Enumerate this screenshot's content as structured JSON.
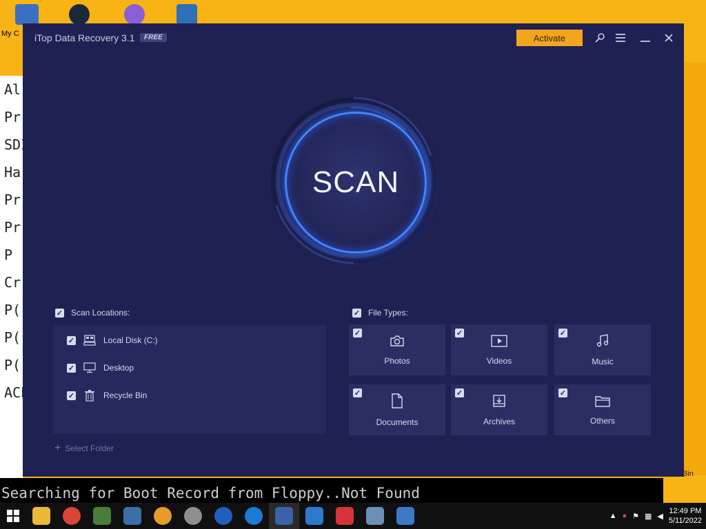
{
  "desktop": {
    "icon_label": "My C",
    "console_lines": [
      "Al",
      "Pr",
      "SDI",
      "Ha",
      "Pr",
      "Pr",
      "P",
      "Cr",
      "P(",
      "P(",
      "P(",
      "ACP"
    ],
    "boot_text": "Searching for Boot Record from Floppy..Not Found",
    "recycle_label": "Bin"
  },
  "window": {
    "title": "iTop Data Recovery 3.1",
    "badge": "FREE",
    "activate_label": "Activate",
    "scan_label": "SCAN"
  },
  "scan_locations": {
    "heading": "Scan Locations:",
    "items": [
      {
        "label": "Local Disk (C:)",
        "icon": "drive-icon"
      },
      {
        "label": "Desktop",
        "icon": "monitor-icon"
      },
      {
        "label": "Recycle Bin",
        "icon": "trash-icon"
      }
    ],
    "select_folder": "Select Folder"
  },
  "file_types": {
    "heading": "File Types:",
    "items": [
      {
        "label": "Photos",
        "icon": "camera-icon"
      },
      {
        "label": "Videos",
        "icon": "video-icon"
      },
      {
        "label": "Music",
        "icon": "music-icon"
      },
      {
        "label": "Documents",
        "icon": "document-icon"
      },
      {
        "label": "Archives",
        "icon": "archive-icon"
      },
      {
        "label": "Others",
        "icon": "folder-icon"
      }
    ]
  },
  "taskbar": {
    "time": "12:49 PM",
    "date": "5/11/2022"
  },
  "colors": {
    "window_bg": "#1f2152",
    "accent_blue": "#3f86ff",
    "activate": "#f3a51d",
    "desktop_bg": "#f7b414"
  }
}
